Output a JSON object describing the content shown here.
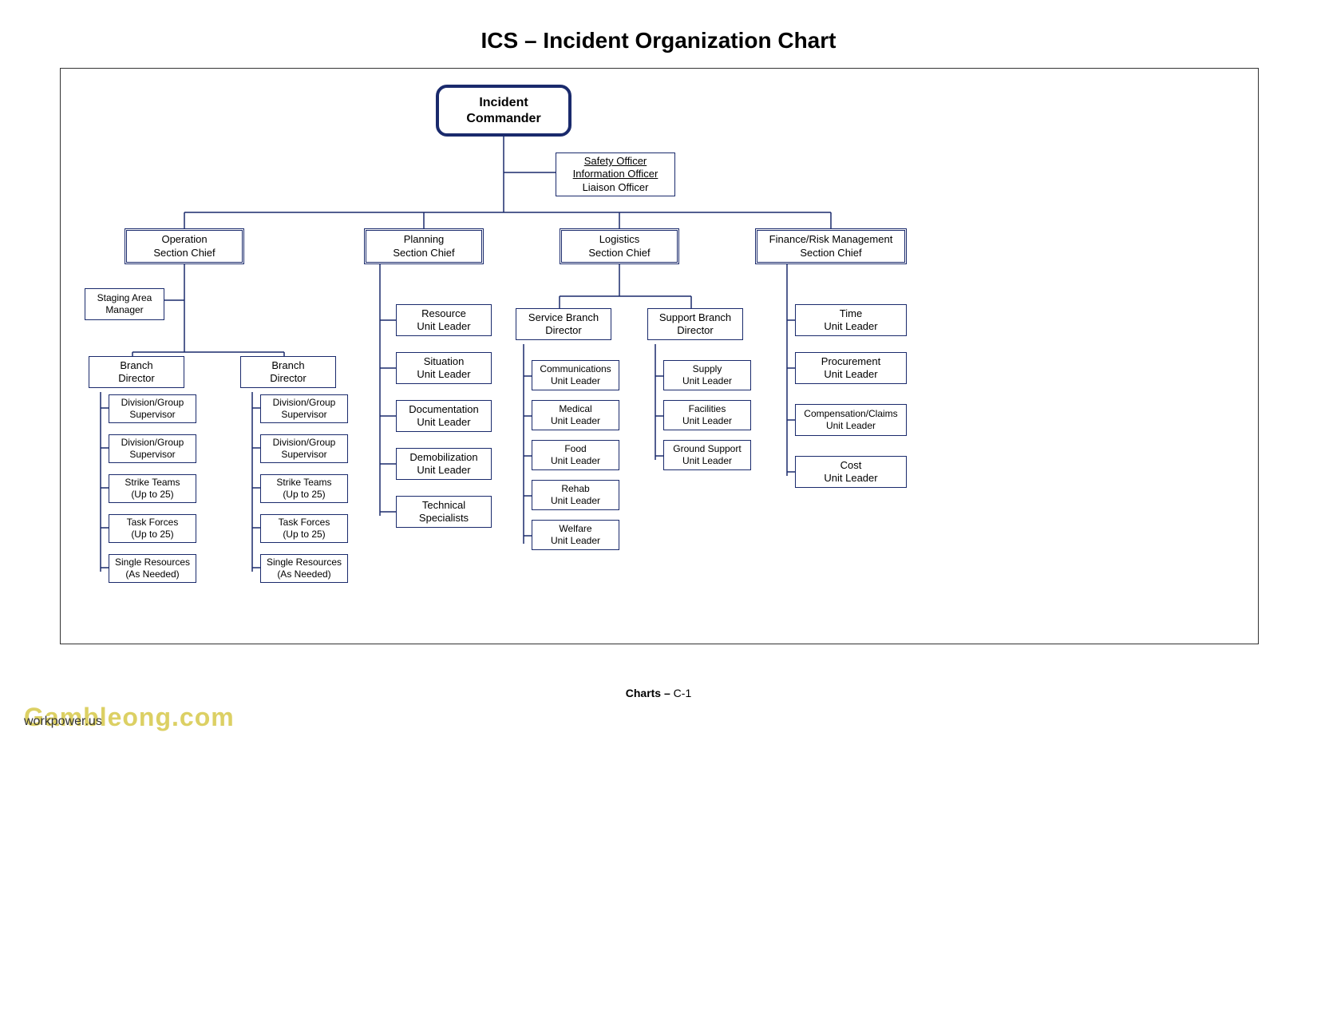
{
  "title": "ICS – Incident Organization Chart",
  "footer_label": "Charts –",
  "footer_page": " C-1",
  "watermark1": "Gambleong.com",
  "watermark2": "workpower.us",
  "commander": {
    "l1": "Incident",
    "l2": "Commander"
  },
  "officers": {
    "l1": "Safety Officer",
    "l2": "Information Officer",
    "l3": "Liaison Officer"
  },
  "sections": {
    "ops": {
      "l1": "Operation",
      "l2": "Section Chief"
    },
    "plan": {
      "l1": "Planning",
      "l2": "Section Chief"
    },
    "log": {
      "l1": "Logistics",
      "l2": "Section Chief"
    },
    "fin": {
      "l1": "Finance/Risk Management",
      "l2": "Section Chief"
    }
  },
  "ops": {
    "staging": {
      "l1": "Staging Area",
      "l2": "Manager"
    },
    "branchA": {
      "l1": "Branch",
      "l2": "Director"
    },
    "branchB": {
      "l1": "Branch",
      "l2": "Director"
    },
    "a1": {
      "l1": "Division/Group",
      "l2": "Supervisor"
    },
    "a2": {
      "l1": "Division/Group",
      "l2": "Supervisor"
    },
    "a3": {
      "l1": "Strike Teams",
      "l2": "(Up to 25)"
    },
    "a4": {
      "l1": "Task Forces",
      "l2": "(Up to 25)"
    },
    "a5": {
      "l1": "Single Resources",
      "l2": "(As Needed)"
    },
    "b1": {
      "l1": "Division/Group",
      "l2": "Supervisor"
    },
    "b2": {
      "l1": "Division/Group",
      "l2": "Supervisor"
    },
    "b3": {
      "l1": "Strike Teams",
      "l2": "(Up to 25)"
    },
    "b4": {
      "l1": "Task Forces",
      "l2": "(Up to 25)"
    },
    "b5": {
      "l1": "Single Resources",
      "l2": "(As Needed)"
    }
  },
  "plan": {
    "u1": {
      "l1": "Resource",
      "l2": "Unit Leader"
    },
    "u2": {
      "l1": "Situation",
      "l2": "Unit Leader"
    },
    "u3": {
      "l1": "Documentation",
      "l2": "Unit Leader"
    },
    "u4": {
      "l1": "Demobilization",
      "l2": "Unit Leader"
    },
    "u5": {
      "l1": "Technical",
      "l2": "Specialists"
    }
  },
  "log": {
    "svc": {
      "l1": "Service Branch",
      "l2": "Director"
    },
    "sup": {
      "l1": "Support Branch",
      "l2": "Director"
    },
    "s1": {
      "l1": "Communications",
      "l2": "Unit Leader"
    },
    "s2": {
      "l1": "Medical",
      "l2": "Unit Leader"
    },
    "s3": {
      "l1": "Food",
      "l2": "Unit Leader"
    },
    "s4": {
      "l1": "Rehab",
      "l2": "Unit Leader"
    },
    "s5": {
      "l1": "Welfare",
      "l2": "Unit Leader"
    },
    "p1": {
      "l1": "Supply",
      "l2": "Unit Leader"
    },
    "p2": {
      "l1": "Facilities",
      "l2": "Unit Leader"
    },
    "p3": {
      "l1": "Ground Support",
      "l2": "Unit Leader"
    }
  },
  "fin": {
    "u1": {
      "l1": "Time",
      "l2": "Unit Leader"
    },
    "u2": {
      "l1": "Procurement",
      "l2": "Unit Leader"
    },
    "u3": {
      "l1": "Compensation/Claims",
      "l2": "Unit Leader"
    },
    "u4": {
      "l1": "Cost",
      "l2": "Unit Leader"
    }
  }
}
